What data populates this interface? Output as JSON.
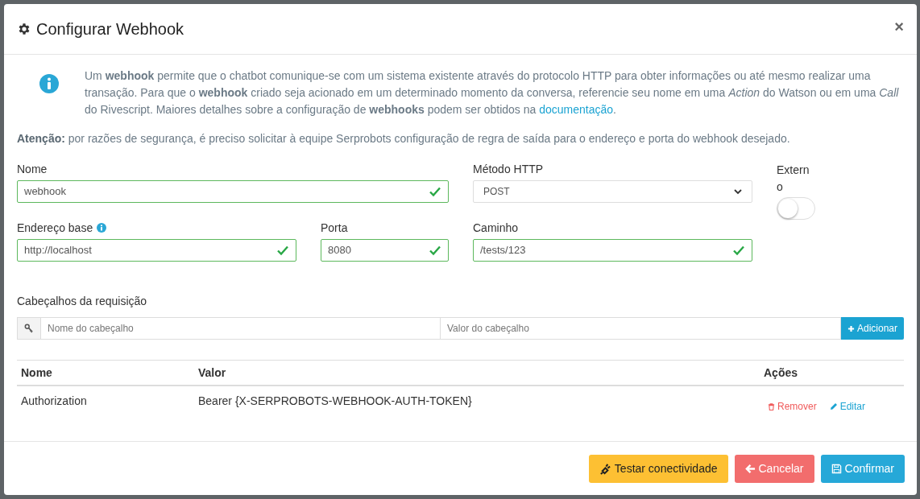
{
  "dialog": {
    "title": "Configurar Webhook",
    "close": "×"
  },
  "info": {
    "text_before": "Um **webhook** permite que o chatbot comunique-se com um sistema existente através do protocolo HTTP para obter informações ou até mesmo realizar uma transação. Para que o **webhook** criado seja acionado em um determinado momento da conversa, referencie seu nome em uma *Action* do Watson ou em uma *Call* do Rivescript. Maiores detalhes sobre a configuração de **webhooks** podem ser obtidos na",
    "link": "documentação",
    "text_after": "."
  },
  "warning": "**Atenção:** por razões de segurança, é preciso solicitar à equipe Serprobots configuração de regra de saída para o endereço e porta do webhook desejado.",
  "fields": [
    {
      "kind": "text",
      "label": "Nome",
      "value": "webhook",
      "valid": true
    },
    {
      "kind": "select",
      "label": "Método HTTP",
      "value": "POST"
    },
    {
      "kind": "toggle",
      "label": "Externo",
      "on": false
    },
    {
      "kind": "text",
      "label": "Endereço base",
      "value": "http://localhost",
      "valid": true,
      "info": true
    },
    {
      "kind": "text",
      "label": "Porta",
      "value": "8080",
      "valid": true
    },
    {
      "kind": "text",
      "label": "Caminho",
      "value": "/tests/123",
      "valid": true
    }
  ],
  "headers_section": {
    "label": "Cabeçalhos da requisição",
    "name_placeholder": "Nome do cabeçalho",
    "value_placeholder": "Valor do cabeçalho",
    "add_button": "Adicionar"
  },
  "table": {
    "columns": [
      "Nome",
      "Valor",
      "Ações"
    ],
    "rows": [
      {
        "name": "Authorization",
        "value": "Bearer {X-SERPROBOTS-WEBHOOK-AUTH-TOKEN}",
        "actions": [
          "Remover",
          "Editar"
        ]
      }
    ]
  },
  "buttons": [
    {
      "kind": "test",
      "label": "Testar conectividade"
    },
    {
      "kind": "cancel",
      "label": "Cancelar"
    },
    {
      "kind": "confirm",
      "label": "Confirmar"
    }
  ]
}
